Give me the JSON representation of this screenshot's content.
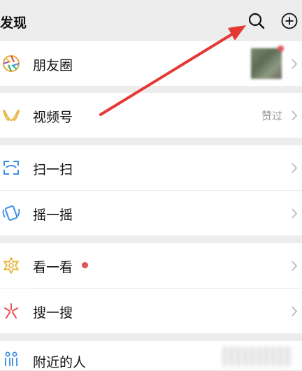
{
  "header": {
    "title": "发现",
    "search_icon": "search-icon",
    "add_icon": "plus-circle-icon"
  },
  "items": [
    {
      "label": "朋友圈",
      "icon": "moments-aperture-icon"
    },
    {
      "label": "视频号",
      "icon": "channels-icon",
      "status": "赞过"
    },
    {
      "label": "扫一扫",
      "icon": "scan-icon"
    },
    {
      "label": "摇一摇",
      "icon": "shake-icon"
    },
    {
      "label": "看一看",
      "icon": "top-stories-icon"
    },
    {
      "label": "搜一搜",
      "icon": "search-sparkle-icon"
    },
    {
      "label": "附近的人",
      "icon": "people-nearby-icon"
    }
  ],
  "colors": {
    "background": "#ededed",
    "card": "#ffffff",
    "badge_red": "#e75252",
    "annotation_arrow": "#e53935"
  }
}
